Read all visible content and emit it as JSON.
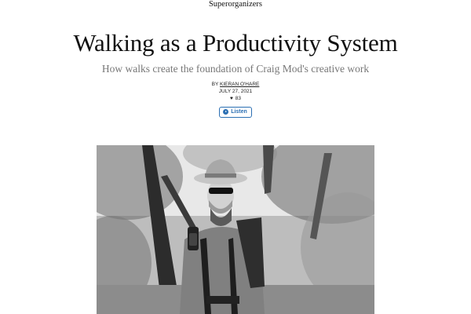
{
  "post": {
    "publication": "Superorganizers",
    "title": "Walking as a Productivity System",
    "subtitle": "How walks create the foundation of Craig Mod's creative work",
    "byline_prefix": "BY",
    "author": "KIERAN O'HARE",
    "date": "JULY 27, 2021",
    "likes": "83",
    "listen_label": "Listen"
  },
  "icons": {
    "heart": "heart-icon",
    "play": "play-circle-icon"
  },
  "colors": {
    "accent": "#2b6fb3",
    "subtitle": "#777777",
    "text": "#111111"
  }
}
